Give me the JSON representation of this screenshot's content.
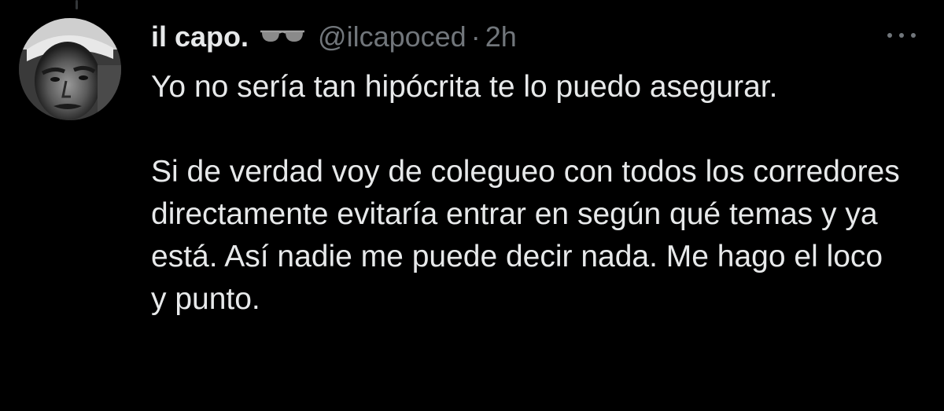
{
  "tweet": {
    "display_name": "il capo.",
    "badge_icon": "sunglasses-icon",
    "handle": "@ilcapoced",
    "separator": "·",
    "time": "2h",
    "more_icon": "more-dots-icon",
    "paragraphs": [
      "Yo no sería tan hipócrita te lo puedo asegurar.",
      "Si de verdad voy de colegueo con todos los corredores directamente evitaría entrar en según qué temas y ya está. Así nadie me puede decir nada. Me hago el loco y punto."
    ]
  },
  "colors": {
    "background": "#000000",
    "primary_text": "#e7e9ea",
    "secondary_text": "#71767b"
  }
}
